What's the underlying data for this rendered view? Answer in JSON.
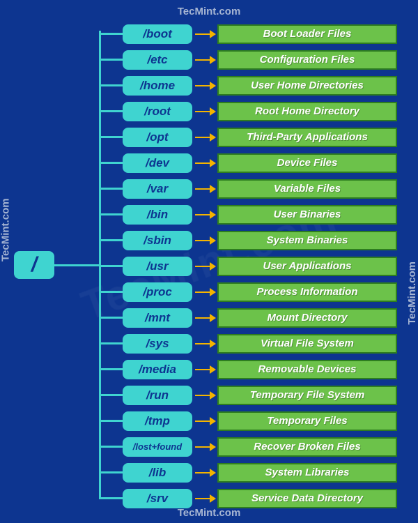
{
  "watermark": "TecMint.com",
  "root": {
    "label": "/"
  },
  "items": [
    {
      "dir": "/boot",
      "desc": "Boot Loader Files"
    },
    {
      "dir": "/etc",
      "desc": "Configuration Files"
    },
    {
      "dir": "/home",
      "desc": "User Home Directories"
    },
    {
      "dir": "/root",
      "desc": "Root Home Directory"
    },
    {
      "dir": "/opt",
      "desc": "Third-Party Applications"
    },
    {
      "dir": "/dev",
      "desc": "Device Files"
    },
    {
      "dir": "/var",
      "desc": "Variable Files"
    },
    {
      "dir": "/bin",
      "desc": "User Binaries"
    },
    {
      "dir": "/sbin",
      "desc": "System Binaries"
    },
    {
      "dir": "/usr",
      "desc": "User Applications"
    },
    {
      "dir": "/proc",
      "desc": "Process Information"
    },
    {
      "dir": "/mnt",
      "desc": "Mount Directory"
    },
    {
      "dir": "/sys",
      "desc": "Virtual File System"
    },
    {
      "dir": "/media",
      "desc": "Removable Devices"
    },
    {
      "dir": "/run",
      "desc": "Temporary File System"
    },
    {
      "dir": "/tmp",
      "desc": "Temporary Files"
    },
    {
      "dir": "/lost+found",
      "desc": "Recover Broken Files",
      "small": true
    },
    {
      "dir": "/lib",
      "desc": "System Libraries"
    },
    {
      "dir": "/srv",
      "desc": "Service Data Directory"
    }
  ]
}
